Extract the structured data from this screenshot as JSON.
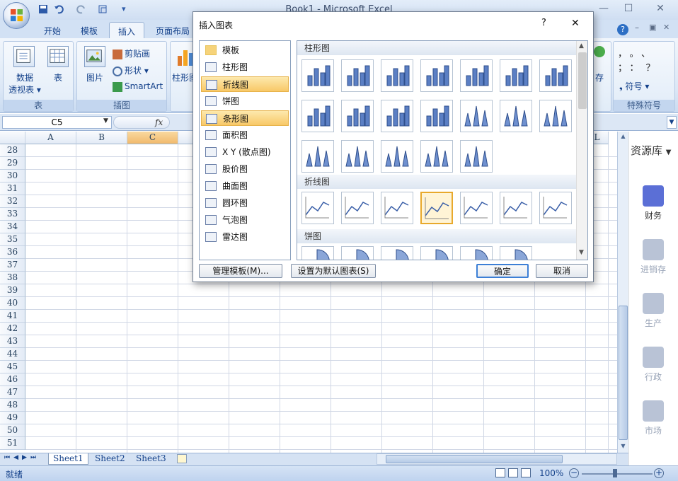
{
  "window": {
    "title": "Book1 - Microsoft Excel"
  },
  "tabs": [
    "开始",
    "模板",
    "插入",
    "页面布局"
  ],
  "ribbon": {
    "table_group": {
      "pivot_label_1": "数据",
      "pivot_label_2": "透视表",
      "table_label": "表",
      "group_label": "表"
    },
    "illust_group": {
      "picture_label": "图片",
      "clipart_label": "剪贴画",
      "shapes_label": "形状",
      "smartart_label": "SmartArt",
      "group_label": "插图"
    },
    "chart_label": "柱形图",
    "symbol_group": {
      "symbols": [
        "，",
        "。",
        "、",
        "；",
        "：",
        "？"
      ],
      "symbol_label": "符号",
      "group_label": "特殊符号"
    },
    "right_fragment": "存"
  },
  "formula_bar": {
    "name_box": "C5",
    "fx": "fx"
  },
  "grid": {
    "columns": [
      "A",
      "B",
      "C",
      "",
      "",
      "",
      "",
      "",
      "",
      "",
      "",
      "L"
    ],
    "rows": [
      "28",
      "29",
      "30",
      "31",
      "32",
      "33",
      "34",
      "35",
      "36",
      "37",
      "38",
      "39",
      "40",
      "41",
      "42",
      "43",
      "44",
      "45",
      "46",
      "47",
      "48",
      "49",
      "50",
      "51"
    ]
  },
  "sheets": [
    "Sheet1",
    "Sheet2",
    "Sheet3"
  ],
  "status": {
    "ready": "就绪",
    "zoom": "100%"
  },
  "side_panel": {
    "title": "资源库",
    "items": [
      {
        "label": "财务",
        "color": "#5b6fd6"
      },
      {
        "label": "进销存",
        "color": "#b9c3d6"
      },
      {
        "label": "生产",
        "color": "#b9c3d6"
      },
      {
        "label": "行政",
        "color": "#b9c3d6"
      },
      {
        "label": "市场",
        "color": "#b9c3d6"
      }
    ]
  },
  "dialog": {
    "title": "插入图表",
    "help": "?",
    "close": "✕",
    "types": [
      {
        "label": "模板",
        "selected": false
      },
      {
        "label": "柱形图",
        "selected": false
      },
      {
        "label": "折线图",
        "selected": true
      },
      {
        "label": "饼图",
        "selected": false
      },
      {
        "label": "条形图",
        "selected": true
      },
      {
        "label": "面积图",
        "selected": false
      },
      {
        "label": "X Y (散点图)",
        "selected": false
      },
      {
        "label": "股价图",
        "selected": false
      },
      {
        "label": "曲面图",
        "selected": false
      },
      {
        "label": "圆环图",
        "selected": false
      },
      {
        "label": "气泡图",
        "selected": false
      },
      {
        "label": "雷达图",
        "selected": false
      }
    ],
    "sections": {
      "column": "柱形图",
      "line": "折线图",
      "pie": "饼图"
    },
    "manage_templates": "管理模板(M)...",
    "set_default": "设置为默认图表(S)",
    "ok": "确定",
    "cancel": "取消"
  }
}
